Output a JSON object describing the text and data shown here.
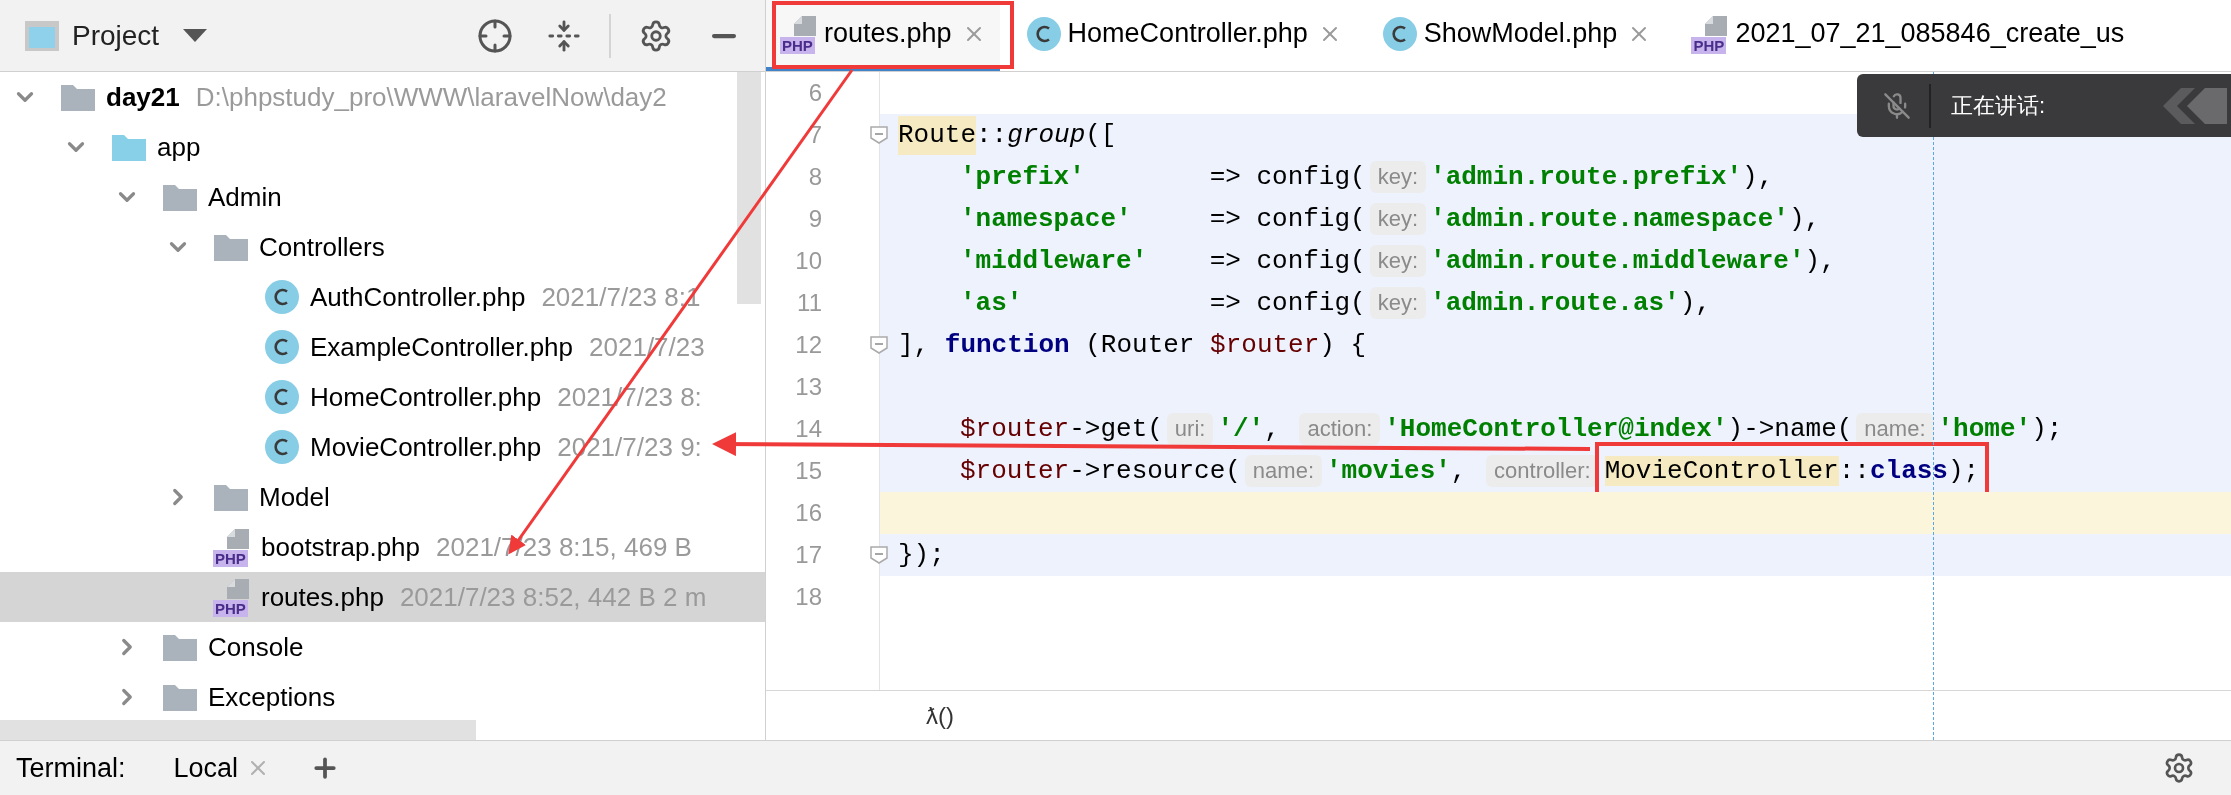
{
  "project_panel": {
    "title": "Project"
  },
  "tree": [
    {
      "name": "day21",
      "detail": "D:\\phpstudy_pro\\WWW\\laravelNow\\day2",
      "kind": "folder",
      "expanded": true,
      "selected": false,
      "children": [
        {
          "name": "app",
          "kind": "source_folder",
          "expanded": true,
          "selected": false,
          "children": [
            {
              "name": "Admin",
              "kind": "folder",
              "expanded": true,
              "selected": false,
              "children": [
                {
                  "name": "Controllers",
                  "kind": "folder",
                  "expanded": true,
                  "selected": false,
                  "children": [
                    {
                      "name": "AuthController.php",
                      "detail": "2021/7/23 8:1",
                      "kind": "class",
                      "selected": false
                    },
                    {
                      "name": "ExampleController.php",
                      "detail": "2021/7/23",
                      "kind": "class",
                      "selected": false
                    },
                    {
                      "name": "HomeController.php",
                      "detail": "2021/7/23 8:",
                      "kind": "class",
                      "selected": false
                    },
                    {
                      "name": "MovieController.php",
                      "detail": "2021/7/23 9:",
                      "kind": "class",
                      "selected": false
                    }
                  ]
                },
                {
                  "name": "Model",
                  "kind": "folder",
                  "expanded": false,
                  "selected": false
                },
                {
                  "name": "bootstrap.php",
                  "detail": "2021/7/23 8:15, 469 B",
                  "kind": "php",
                  "badge": "PHP",
                  "selected": false
                },
                {
                  "name": "routes.php",
                  "detail": "2021/7/23 8:52, 442 B 2 m",
                  "kind": "php",
                  "badge": "PHP",
                  "selected": true
                }
              ]
            },
            {
              "name": "Console",
              "kind": "folder",
              "expanded": false,
              "selected": false
            },
            {
              "name": "Exceptions",
              "kind": "folder",
              "expanded": false,
              "selected": false
            }
          ]
        }
      ]
    }
  ],
  "tabs": [
    {
      "label": "routes.php",
      "kind": "php",
      "badge": "PHP",
      "selected": true,
      "closable": true
    },
    {
      "label": "HomeController.php",
      "kind": "class",
      "selected": false,
      "closable": true
    },
    {
      "label": "ShowModel.php",
      "kind": "class",
      "selected": false,
      "closable": true
    },
    {
      "label": "2021_07_21_085846_create_us",
      "kind": "php",
      "badge": "PHP",
      "selected": false,
      "closable": false
    }
  ],
  "code_lines": [
    {
      "number": "6",
      "scoped": false,
      "fold": false
    },
    {
      "number": "7",
      "scoped": true,
      "fold": true,
      "tokens": [
        {
          "kind": "highlight",
          "text": "Route"
        },
        {
          "kind": "plain",
          "text": "::"
        },
        {
          "kind": "italic",
          "text": "group"
        },
        {
          "kind": "plain",
          "text": "(["
        }
      ]
    },
    {
      "number": "8",
      "scoped": true,
      "fold": false,
      "indent": true,
      "tokens": [
        {
          "kind": "string",
          "text": "'prefix'"
        },
        {
          "kind": "plain",
          "text": "        => config("
        },
        {
          "kind": "hint",
          "text": "key:"
        },
        {
          "kind": "string",
          "text": "'admin.route.prefix'"
        },
        {
          "kind": "plain",
          "text": "),"
        }
      ]
    },
    {
      "number": "9",
      "scoped": true,
      "fold": false,
      "indent": true,
      "tokens": [
        {
          "kind": "string",
          "text": "'namespace'"
        },
        {
          "kind": "plain",
          "text": "     => config("
        },
        {
          "kind": "hint",
          "text": "key:"
        },
        {
          "kind": "string",
          "text": "'admin.route.namespace'"
        },
        {
          "kind": "plain",
          "text": "),"
        }
      ]
    },
    {
      "number": "10",
      "scoped": true,
      "fold": false,
      "indent": true,
      "tokens": [
        {
          "kind": "string",
          "text": "'middleware'"
        },
        {
          "kind": "plain",
          "text": "    => config("
        },
        {
          "kind": "hint",
          "text": "key:"
        },
        {
          "kind": "string",
          "text": "'admin.route.middleware'"
        },
        {
          "kind": "plain",
          "text": "),"
        }
      ]
    },
    {
      "number": "11",
      "scoped": true,
      "fold": false,
      "indent": true,
      "tokens": [
        {
          "kind": "string",
          "text": "'as'"
        },
        {
          "kind": "plain",
          "text": "            => config("
        },
        {
          "kind": "hint",
          "text": "key:"
        },
        {
          "kind": "string",
          "text": "'admin.route.as'"
        },
        {
          "kind": "plain",
          "text": "),"
        }
      ]
    },
    {
      "number": "12",
      "scoped": true,
      "fold": true,
      "tokens": [
        {
          "kind": "plain",
          "text": "], "
        },
        {
          "kind": "keyword",
          "text": "function"
        },
        {
          "kind": "plain",
          "text": " (Router "
        },
        {
          "kind": "variable",
          "text": "$router"
        },
        {
          "kind": "plain",
          "text": ") {"
        }
      ]
    },
    {
      "number": "13",
      "scoped": true,
      "fold": false
    },
    {
      "number": "14",
      "scoped": true,
      "fold": false,
      "indent": true,
      "tokens": [
        {
          "kind": "variable",
          "text": "$router"
        },
        {
          "kind": "plain",
          "text": "->get("
        },
        {
          "kind": "hint",
          "text": "uri:"
        },
        {
          "kind": "string",
          "text": "'/'"
        },
        {
          "kind": "plain",
          "text": ", "
        },
        {
          "kind": "hint",
          "text": "action:"
        },
        {
          "kind": "string",
          "text": "'HomeController@index'"
        },
        {
          "kind": "plain",
          "text": ")->name("
        },
        {
          "kind": "hint",
          "text": "name:"
        },
        {
          "kind": "string",
          "text": "'home'"
        },
        {
          "kind": "plain",
          "text": ");"
        }
      ]
    },
    {
      "number": "15",
      "scoped": true,
      "fold": false,
      "indent": true,
      "tokens": [
        {
          "kind": "variable",
          "text": "$router"
        },
        {
          "kind": "plain",
          "text": "->resource("
        },
        {
          "kind": "hint",
          "text": "name:"
        },
        {
          "kind": "string",
          "text": "'movies'"
        },
        {
          "kind": "plain",
          "text": ", "
        },
        {
          "kind": "hint",
          "text": "controller:"
        },
        {
          "kind": "highlight",
          "text": "MovieController",
          "framed": true
        },
        {
          "kind": "plain",
          "text": "::",
          "framed": true
        },
        {
          "kind": "keyword",
          "text": "class",
          "framed": true
        },
        {
          "kind": "plain",
          "text": ");",
          "framed": true
        }
      ]
    },
    {
      "number": "16",
      "current": true,
      "fold": false
    },
    {
      "number": "17",
      "scoped": true,
      "fold": true,
      "tokens": [
        {
          "kind": "plain",
          "text": "});"
        }
      ]
    },
    {
      "number": "18",
      "scoped": false,
      "fold": false
    }
  ],
  "breadcrumb": "ƛ()",
  "popup": {
    "text": "正在讲话:"
  },
  "bottom_bar": {
    "label": "Terminal:",
    "tabs": [
      {
        "label": "Local",
        "selected": true
      }
    ]
  }
}
